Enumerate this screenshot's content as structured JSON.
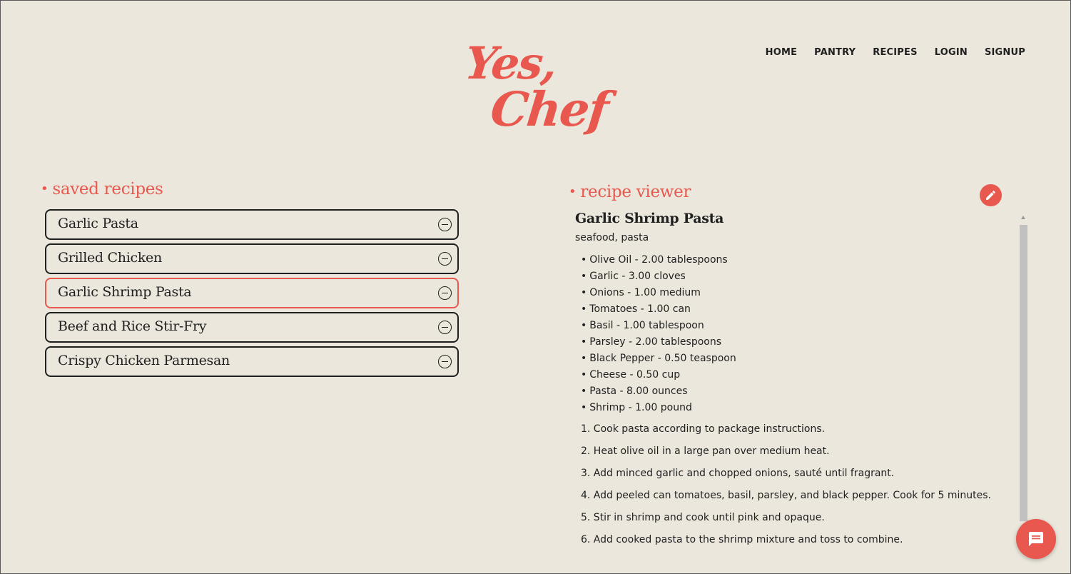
{
  "brand": {
    "line1": "Yes,",
    "line2": "Chef",
    "color": "#e8584e"
  },
  "nav": {
    "items": [
      {
        "label": "HOME"
      },
      {
        "label": "PANTRY"
      },
      {
        "label": "RECIPES"
      },
      {
        "label": "LOGIN"
      },
      {
        "label": "SIGNUP"
      }
    ]
  },
  "saved": {
    "heading": "saved recipes",
    "recipes": [
      {
        "name": "Garlic Pasta",
        "active": false
      },
      {
        "name": "Grilled Chicken",
        "active": false
      },
      {
        "name": "Garlic Shrimp Pasta",
        "active": true
      },
      {
        "name": "Beef and Rice Stir-Fry",
        "active": false
      },
      {
        "name": "Crispy Chicken Parmesan",
        "active": false
      }
    ]
  },
  "viewer": {
    "heading": "recipe viewer",
    "title": "Garlic Shrimp Pasta",
    "tags": "seafood, pasta",
    "ingredients": [
      "Olive Oil - 2.00 tablespoons",
      "Garlic - 3.00 cloves",
      "Onions - 1.00 medium",
      "Tomatoes - 1.00 can",
      "Basil - 1.00 tablespoon",
      "Parsley - 2.00 tablespoons",
      "Black Pepper - 0.50 teaspoon",
      "Cheese - 0.50 cup",
      "Pasta - 8.00 ounces",
      "Shrimp - 1.00 pound"
    ],
    "steps": [
      "1. Cook pasta according to package instructions.",
      "2. Heat olive oil in a large pan over medium heat.",
      "3. Add minced garlic and chopped onions, sauté until fragrant.",
      "4. Add peeled can tomatoes, basil, parsley, and black pepper. Cook for 5 minutes.",
      "5. Stir in shrimp and cook until pink and opaque.",
      "6. Add cooked pasta to the shrimp mixture and toss to combine."
    ]
  },
  "icons": {
    "edit": "pencil-icon",
    "remove": "minus-circle-icon",
    "chat": "chat-bubble-icon"
  },
  "colors": {
    "background": "#ebe7dc",
    "accent": "#e8584e",
    "text": "#1f1f1f"
  }
}
